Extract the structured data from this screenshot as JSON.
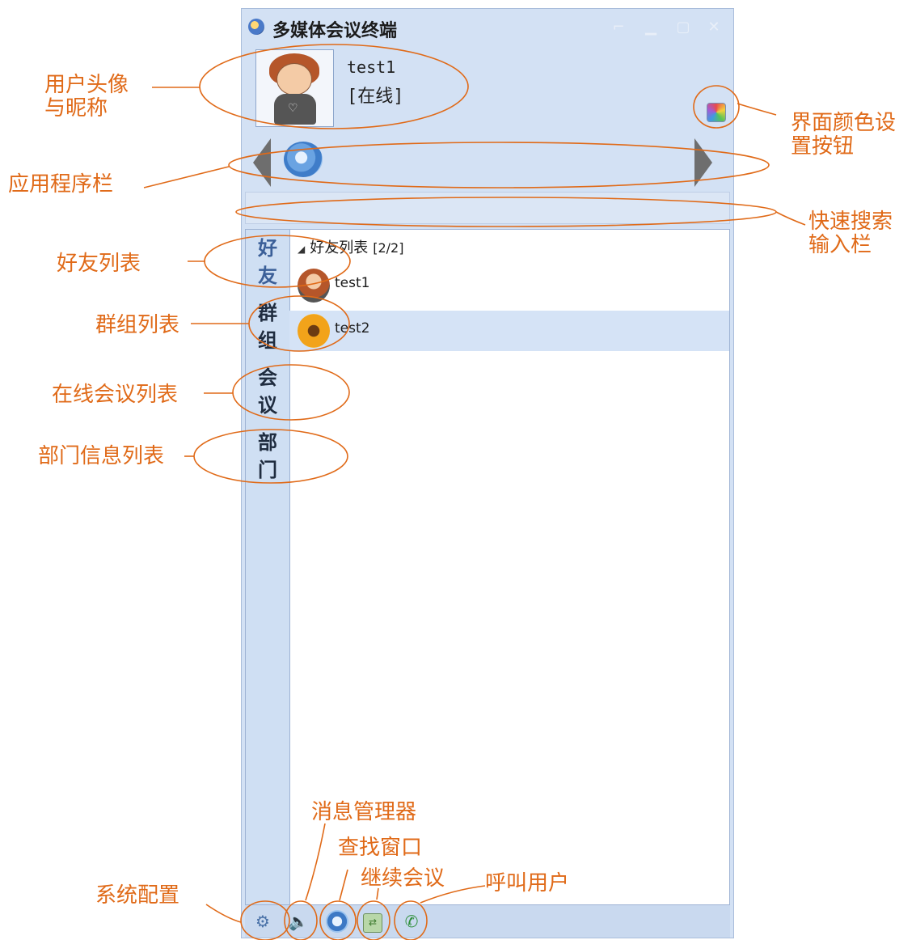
{
  "window": {
    "title": "多媒体会议终端",
    "controls": [
      "pin",
      "minimize",
      "maximize",
      "close"
    ]
  },
  "user": {
    "nickname": "test1",
    "status": "[在线]"
  },
  "side_tabs": [
    {
      "label": "好友",
      "active": true
    },
    {
      "label": "群组",
      "active": false
    },
    {
      "label": "会议",
      "active": false
    },
    {
      "label": "部门",
      "active": false
    }
  ],
  "contact_group": {
    "name": "好友列表",
    "count": "[2/2]",
    "contacts": [
      {
        "name": "test1",
        "selected": false
      },
      {
        "name": "test2",
        "selected": true
      }
    ]
  },
  "annotations": {
    "avatar_nickname_1": "用户头像",
    "avatar_nickname_2": "与昵称",
    "app_bar": "应用程序栏",
    "color_settings_1": "界面颜色设",
    "color_settings_2": "置按钮",
    "quick_search_1": "快速搜索",
    "quick_search_2": "输入栏",
    "friends_list": "好友列表",
    "group_list": "群组列表",
    "meeting_list": "在线会议列表",
    "department_list": "部门信息列表",
    "message_manager": "消息管理器",
    "find_window": "查找窗口",
    "continue_meeting": "继续会议",
    "call_user": "呼叫用户",
    "system_config": "系统配置"
  },
  "icons": {
    "app": "conference-app-icon",
    "color_settings": "color-palette-icon",
    "app_bar_item": "disc-app-icon",
    "bottom_tools": [
      "gear-icon",
      "speaker-icon",
      "search-icon",
      "continue-meeting-icon",
      "phone-icon"
    ]
  },
  "colors": {
    "window_bg": "#d3e1f4",
    "annotation": "#e06a18",
    "selected_row": "#d5e3f6"
  }
}
